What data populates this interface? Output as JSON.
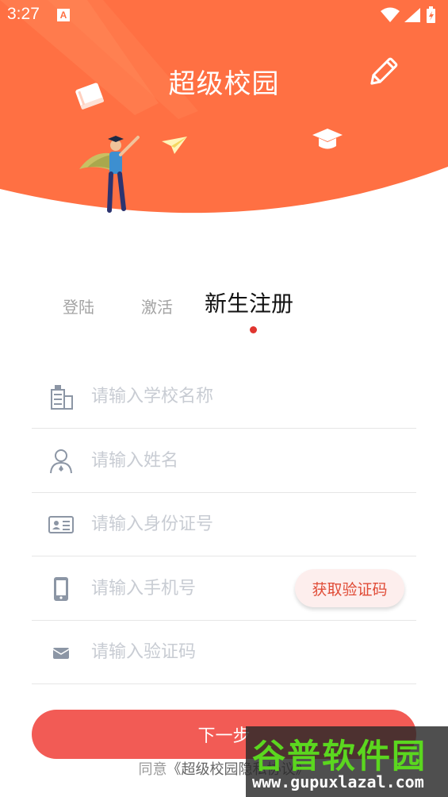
{
  "status_bar": {
    "time": "3:27",
    "notification_letter": "A"
  },
  "header": {
    "title": "超级校园",
    "colors": {
      "background": "#ff7043",
      "text": "#ffffff"
    },
    "icons": [
      "book-icon",
      "pencil-icon",
      "paper-plane-icon",
      "graduation-cap-icon",
      "student-illustration"
    ]
  },
  "tabs": [
    {
      "label": "登陆",
      "active": false
    },
    {
      "label": "激活",
      "active": false
    },
    {
      "label": "新生注册",
      "active": true
    }
  ],
  "form": {
    "school": {
      "placeholder": "请输入学校名称",
      "value": "",
      "icon": "building-icon"
    },
    "name": {
      "placeholder": "请输入姓名",
      "value": "",
      "icon": "person-icon"
    },
    "id_card": {
      "placeholder": "请输入身份证号",
      "value": "",
      "icon": "id-card-icon"
    },
    "phone": {
      "placeholder": "请输入手机号",
      "value": "",
      "icon": "phone-icon"
    },
    "code": {
      "placeholder": "请输入验证码",
      "value": "",
      "icon": "envelope-icon"
    },
    "get_code_label": "获取验证码"
  },
  "next_label": "下一步",
  "agreement": {
    "prefix": "同意",
    "link": "《超级校园隐私协议》"
  },
  "watermark": {
    "brand": "谷普软件园",
    "url": "www.gupuxlazal.com"
  },
  "colors": {
    "accent": "#f25b55",
    "code_button_bg": "#fdeeed",
    "code_button_text": "#e04b36",
    "placeholder": "#c8ccd3",
    "active_dot": "#e0352f"
  }
}
